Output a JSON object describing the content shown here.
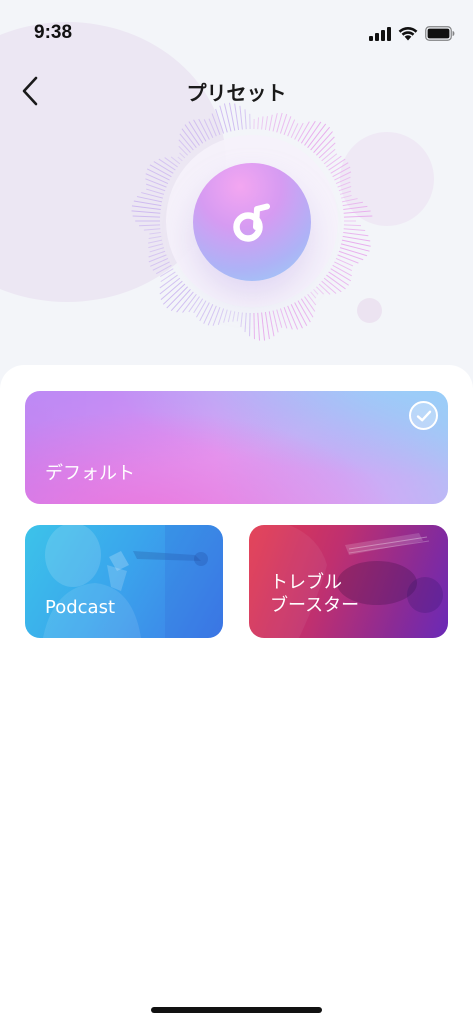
{
  "status_bar": {
    "time": "9:38",
    "icons": [
      "cellular-signal-icon",
      "wifi-icon",
      "battery-icon"
    ]
  },
  "nav": {
    "back_icon": "chevron-left-icon",
    "title": "プリセット"
  },
  "logo": {
    "icon": "music-note-icon"
  },
  "presets": [
    {
      "id": "default",
      "label": "デフォルト",
      "selected": true,
      "check_icon": "checkmark-icon"
    },
    {
      "id": "podcast",
      "label": "Podcast",
      "selected": false
    },
    {
      "id": "treble",
      "label": "トレブル\nブースター",
      "selected": false
    }
  ],
  "colors": {
    "background": "#f3f5f9",
    "sheet": "#ffffff",
    "accent_pink": "#e69af3",
    "accent_blue": "#3aa6ec",
    "accent_red": "#e33a4f",
    "accent_purple": "#6a29b7"
  }
}
